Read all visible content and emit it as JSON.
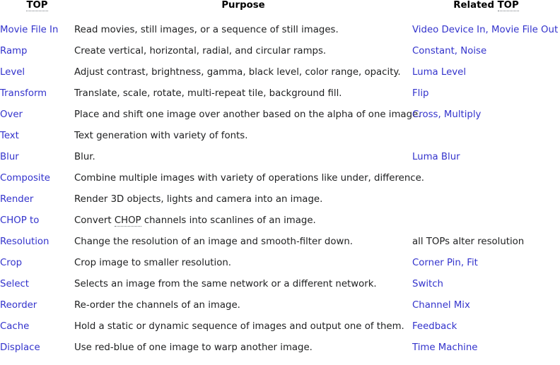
{
  "table": {
    "headers": [
      {
        "text": "TOP",
        "abbr_part": "TOP",
        "prefix": ""
      },
      {
        "text": "Purpose",
        "abbr_part": "",
        "prefix": "Purpose"
      },
      {
        "text": "Related TOP",
        "abbr_part": "TOP",
        "prefix": "Related "
      }
    ],
    "header_top": "TOP",
    "header_purpose": "Purpose",
    "header_related_prefix": "Related ",
    "header_related_abbr": "TOP",
    "rows": [
      {
        "top": "Movie File In",
        "purpose": "Read movies, still images, or a sequence of still images.",
        "related": [
          "Video Device In",
          "Movie File Out"
        ]
      },
      {
        "top": "Ramp",
        "purpose": "Create vertical, horizontal, radial, and circular ramps.",
        "related": [
          "Constant",
          "Noise"
        ]
      },
      {
        "top": "Level",
        "purpose": "Adjust contrast, brightness, gamma, black level, color range, opacity.",
        "related": [
          "Luma Level"
        ]
      },
      {
        "top": "Transform",
        "purpose": "Translate, scale, rotate, multi-repeat tile, background fill.",
        "related": [
          "Flip"
        ]
      },
      {
        "top": "Over",
        "purpose": "Place and shift one image over another based on the alpha of one image.",
        "related": [
          "Cross",
          "Multiply"
        ]
      },
      {
        "top": "Text",
        "purpose": "Text generation with variety of fonts.",
        "related": []
      },
      {
        "top": "Blur",
        "purpose": "Blur.",
        "related": [
          "Luma Blur"
        ]
      },
      {
        "top": "Composite",
        "purpose": "Combine multiple images with variety of operations like under, difference.",
        "related": []
      },
      {
        "top": "Render",
        "purpose": "Render 3D objects, lights and camera into an image.",
        "related": []
      },
      {
        "top": "CHOP to",
        "purpose_prefix": "Convert ",
        "purpose_abbr": "CHOP",
        "purpose_suffix": " channels into scanlines of an image.",
        "purpose": "Convert CHOP channels into scanlines of an image.",
        "related": []
      },
      {
        "top": "Resolution",
        "purpose": "Change the resolution of an image and smooth-filter down.",
        "related": [],
        "related_plain": "all TOPs alter resolution"
      },
      {
        "top": "Crop",
        "purpose": "Crop image to smaller resolution.",
        "related": [
          "Corner Pin",
          "Fit"
        ]
      },
      {
        "top": "Select",
        "purpose": "Selects an image from the same network or a different network.",
        "related": [
          "Switch"
        ]
      },
      {
        "top": "Reorder",
        "purpose": "Re-order the channels of an image.",
        "related": [
          "Channel Mix"
        ]
      },
      {
        "top": "Cache",
        "purpose": "Hold a static or dynamic sequence of images and output one of them.",
        "related": [
          "Feedback"
        ]
      },
      {
        "top": "Displace",
        "purpose": "Use red-blue of one image to warp another image.",
        "related": [
          "Time Machine"
        ]
      }
    ],
    "separator": ", "
  },
  "colors": {
    "link": "#3333cc",
    "text": "#202122",
    "heading": "#000000",
    "abbr_underline": "#72777d",
    "background": "#ffffff"
  }
}
